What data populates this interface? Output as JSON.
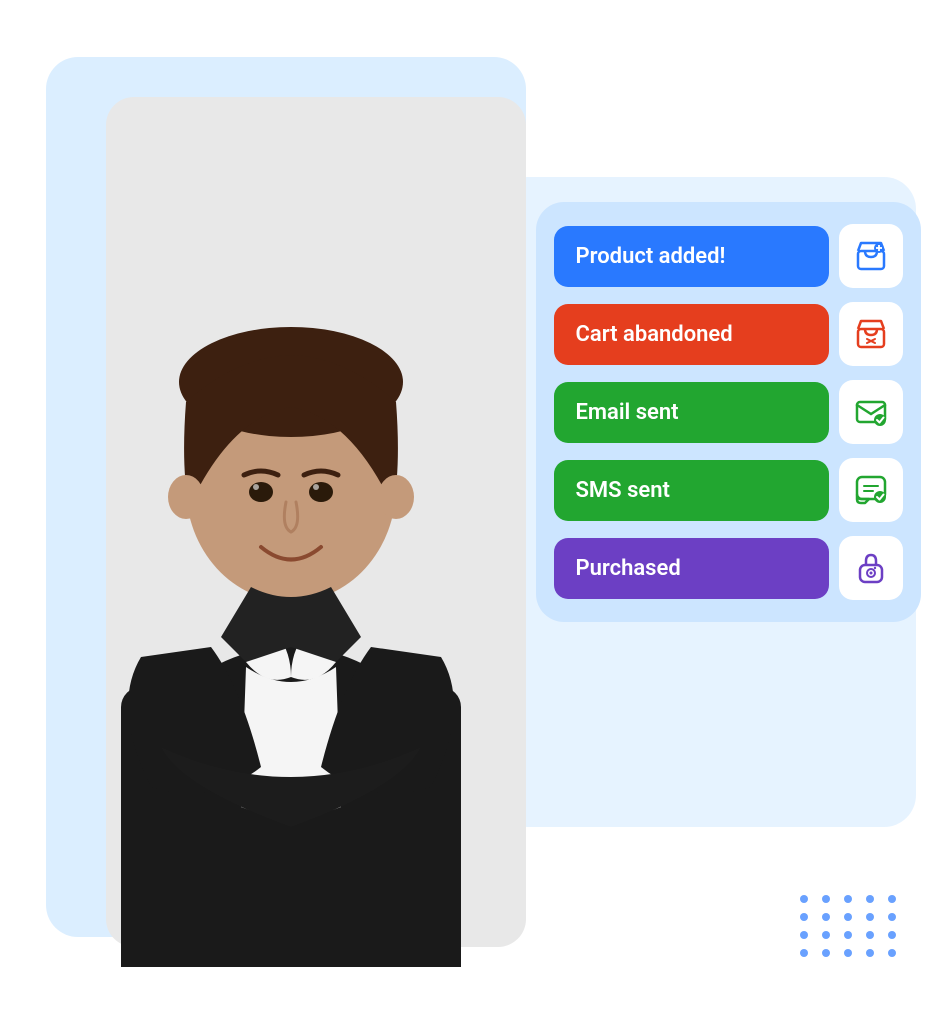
{
  "scene": {
    "background_color": "#ffffff",
    "accent_color": "#b8d9f8"
  },
  "card": {
    "background_color": "#c5dff8",
    "items": [
      {
        "id": "product-added",
        "label": "Product added!",
        "color_class": "blue",
        "bg_color": "#2979ff",
        "icon_type": "store",
        "icon_color": "#2979ff"
      },
      {
        "id": "cart-abandoned",
        "label": "Cart abandoned",
        "color_class": "red",
        "bg_color": "#e53e1e",
        "icon_type": "store-bag",
        "icon_color": "#e53e1e"
      },
      {
        "id": "email-sent",
        "label": "Email sent",
        "color_class": "green",
        "bg_color": "#22a630",
        "icon_type": "email",
        "icon_color": "#22a630"
      },
      {
        "id": "sms-sent",
        "label": "SMS sent",
        "color_class": "green",
        "bg_color": "#22a630",
        "icon_type": "sms",
        "icon_color": "#22a630"
      },
      {
        "id": "purchased",
        "label": "Purchased",
        "color_class": "purple",
        "bg_color": "#6c3fc4",
        "icon_type": "lock",
        "icon_color": "#6c3fc4"
      }
    ]
  },
  "dots": {
    "color": "#2979ff",
    "rows": 4,
    "cols": 5
  }
}
